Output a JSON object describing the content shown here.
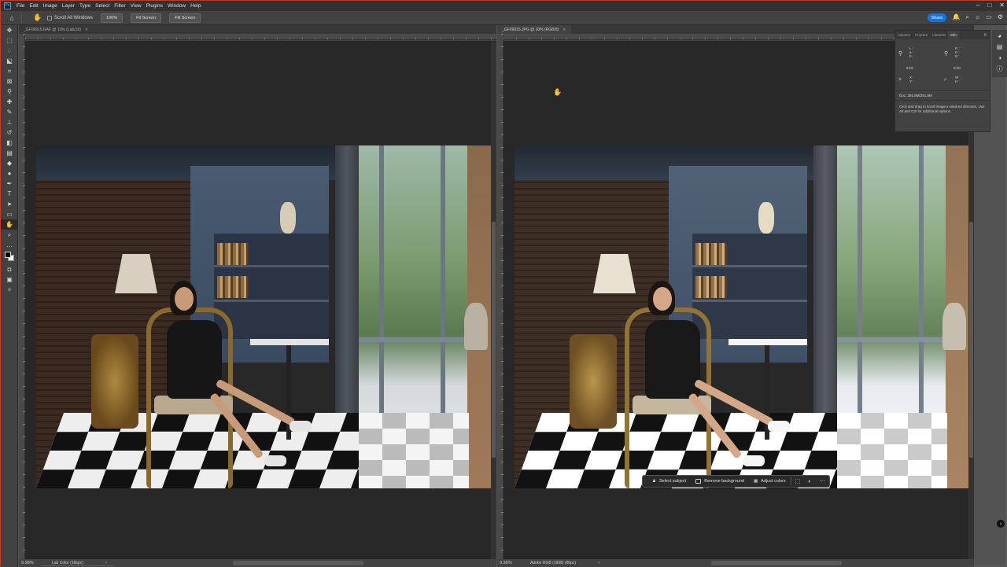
{
  "menubar": {
    "items": [
      "File",
      "Edit",
      "Image",
      "Layer",
      "Type",
      "Select",
      "Filter",
      "View",
      "Plugins",
      "Window",
      "Help"
    ],
    "app_logo": "Ps"
  },
  "options": {
    "scroll_all_windows": "Scroll All Windows",
    "zoom_100": "100%",
    "fit_screen": "Fit Screen",
    "fill_screen": "Fill Screen",
    "share": "Share"
  },
  "tools": [
    "move-icon",
    "marquee-icon",
    "lasso-icon",
    "object-select-icon",
    "crop-icon",
    "frame-icon",
    "eyedropper-icon",
    "spot-heal-icon",
    "brush-icon",
    "clone-stamp-icon",
    "history-brush-icon",
    "eraser-icon",
    "gradient-icon",
    "blur-icon",
    "dodge-icon",
    "pen-icon",
    "type-icon",
    "path-select-icon",
    "rectangle-icon",
    "hand-icon",
    "zoom-icon",
    "more-tools-icon"
  ],
  "documents": {
    "left": {
      "tab_title": "_GF09915.RAF @ 10% (Lab/16)",
      "zoom": "9.98%",
      "profile": "Lab Color (16bpc)"
    },
    "right": {
      "tab_title": "_GF09915.JPG @ 10% (RGB/8)",
      "zoom": "9.98%",
      "profile": "Adobe RGB (1998) (8bpc)"
    }
  },
  "taskbar": {
    "select_subject": "Select subject",
    "remove_background": "Remove background",
    "adjust_colors": "Adjust colors"
  },
  "panel": {
    "tabs": [
      "Adjustm",
      "Properti",
      "Libraries",
      "Info"
    ],
    "active_tab": "Info",
    "bit_left": "8-bit",
    "bit_right": "8-bit",
    "doc_size": "Doc: 291.8M/291.8M",
    "hint": "Click and drag to scroll image in desired direction.  Use Alt and Ctrl for additional options."
  }
}
